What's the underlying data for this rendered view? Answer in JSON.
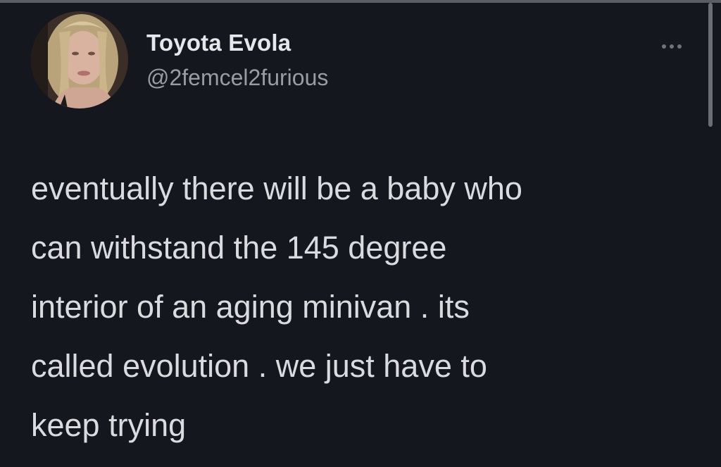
{
  "tweet": {
    "author": {
      "display_name": "Toyota Evola",
      "handle": "@2femcel2furious",
      "avatar_icon": "profile-photo"
    },
    "more_icon": "more-horizontal-icon",
    "text": "eventually there will be a baby who\ncan withstand the 145 degree\ninterior of an aging minivan . its\ncalled evolution . we just have to\nkeep trying"
  },
  "colors": {
    "background": "#15171f",
    "text": "#dadbde",
    "secondary_text": "#9a9ca3"
  }
}
